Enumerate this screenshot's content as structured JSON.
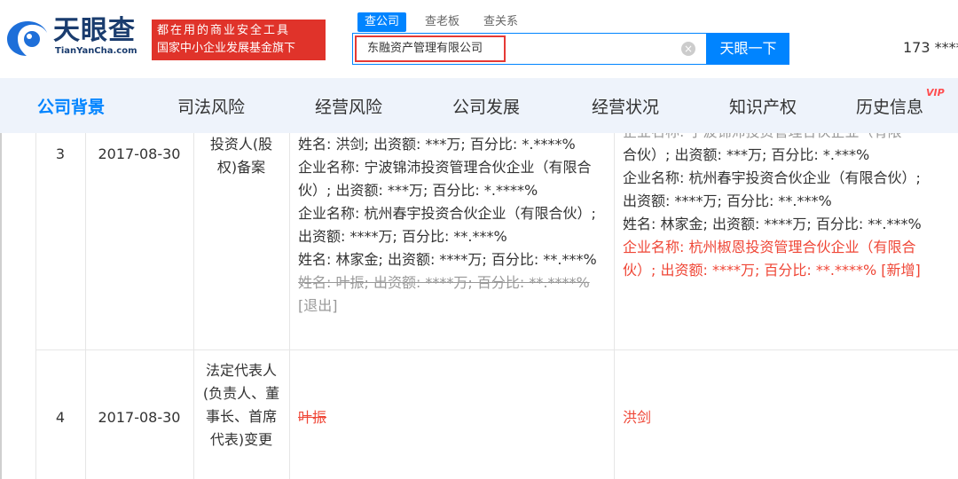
{
  "brand": {
    "name_cn": "天眼查",
    "name_en": "TianYanCha.com",
    "slogan_line1": "都在用的商业安全工具",
    "slogan_line2": "国家中小企业发展基金旗下"
  },
  "search": {
    "tabs": [
      "查公司",
      "查老板",
      "查关系"
    ],
    "query": "东融资产管理有限公司",
    "button": "天眼一下"
  },
  "user": {
    "phone": "173 ****"
  },
  "nav": {
    "items": [
      "公司背景",
      "司法风险",
      "经营风险",
      "公司发展",
      "经营状况",
      "知识产权",
      "历史信息"
    ],
    "vip": "VIP"
  },
  "rows": [
    {
      "index": "3",
      "date": "2017-08-30",
      "item": "投资人(股权)备案",
      "before": [
        "姓名: 洪剑; 出资额: ***万; 百分比: *.****%",
        "企业名称: 宁波锦沛投资管理合伙企业（有限合伙）; 出资额: ***万; 百分比: *.****%",
        "企业名称: 杭州春宇投资合伙企业（有限合伙）; 出资额: ****万; 百分比: **.***%",
        "姓名: 林家金; 出资额: ****万; 百分比: **.***%",
        "姓名: 叶振; 出资额: ****万; 百分比: **.****%",
        "[退出]"
      ],
      "after": [
        "企业名称: 宁波锦沛投资管理合伙企业（有限",
        "合伙）; 出资额: ***万; 百分比: *.***%",
        "企业名称: 杭州春宇投资合伙企业（有限合伙）; 出资额: ****万; 百分比: **.***%",
        "姓名: 林家金; 出资额: ****万; 百分比: **.***%",
        "企业名称: 杭州椒恩投资管理合伙企业（有限合伙）; 出资额: ****万; 百分比: **.****% [新增]"
      ]
    },
    {
      "index": "4",
      "date": "2017-08-30",
      "item": "法定代表人(负责人、董事长、首席代表)变更",
      "before": "叶振",
      "after": "洪剑"
    }
  ]
}
